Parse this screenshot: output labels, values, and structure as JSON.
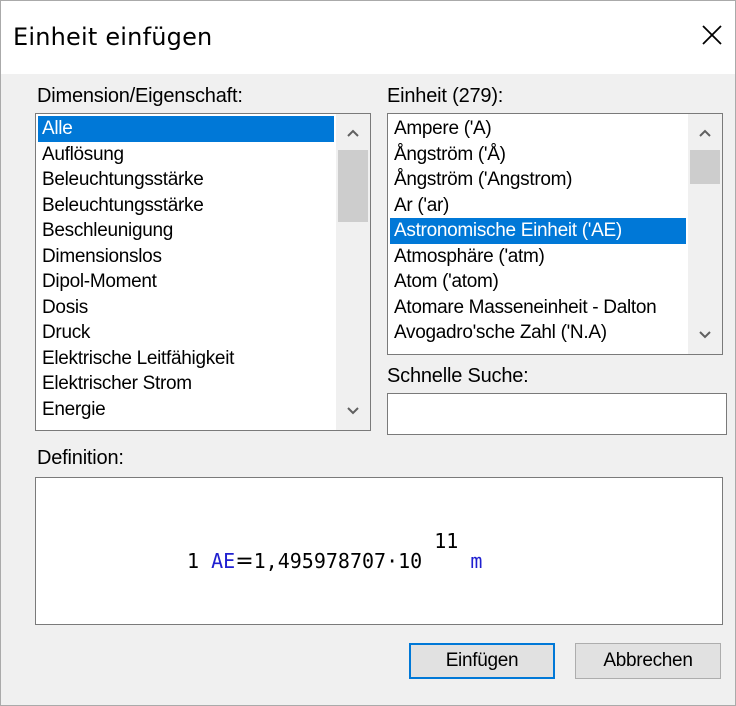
{
  "dialog": {
    "title": "Einheit einfügen"
  },
  "dimension": {
    "label": "Dimension/Eigenschaft:",
    "items": [
      "Alle",
      "Auflösung",
      "Beleuchtungsstärke",
      "Beleuchtungsstärke",
      "Beschleunigung",
      "Dimensionslos",
      "Dipol-Moment",
      "Dosis",
      "Druck",
      "Elektrische Leitfähigkeit",
      "Elektrischer Strom",
      "Energie"
    ],
    "selected_index": 0
  },
  "unit": {
    "label": "Einheit (279):",
    "items": [
      "Ampere ('A)",
      "Ångström ('Å)",
      "Ångström ('Angstrom)",
      "Ar ('ar)",
      "Astronomische Einheit ('AE)",
      "Atmosphäre ('atm)",
      "Atom ('atom)",
      "Atomare Masseneinheit - Dalton",
      "Avogadro'sche Zahl ('N.A)"
    ],
    "selected_index": 4
  },
  "search": {
    "label": "Schnelle Suche:",
    "value": ""
  },
  "definition": {
    "label": "Definition:",
    "lhs_number": "1",
    "lhs_unit": "AE",
    "equals": "=",
    "mantissa": "1,495978707",
    "dot": "·",
    "base": "10",
    "exponent": "11",
    "rhs_unit": "m"
  },
  "buttons": {
    "insert": "Einfügen",
    "cancel": "Abbrechen"
  },
  "colors": {
    "selection": "#0078d7",
    "unit_text": "#2020d0"
  }
}
